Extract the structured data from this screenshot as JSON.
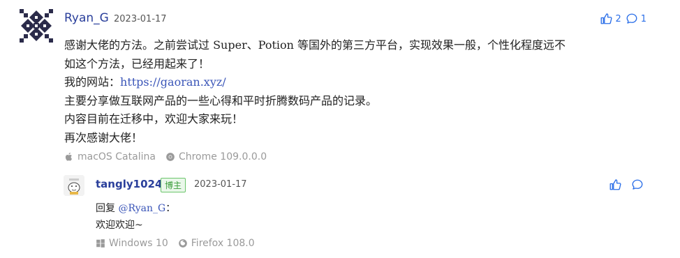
{
  "comment": {
    "author": "Ryan_G",
    "date": "2023-01-17",
    "like_count": "2",
    "reply_count": "1",
    "lines": {
      "line1": "感谢大佬的方法。之前尝试过 Super、Potion 等国外的第三方平台，实现效果一般，个性化程度远不",
      "line2": "如这个方法，已经用起来了！",
      "site_prefix": "我的网站：",
      "site_url": "https://gaoran.xyz/",
      "line4": "主要分享做互联网产品的一些心得和平时折腾数码产品的记录。",
      "line5": "内容目前在迁移中，欢迎大家来玩！",
      "line6": "再次感谢大佬！"
    },
    "os": "macOS Catalina",
    "browser": "Chrome 109.0.0.0"
  },
  "reply": {
    "author": "tangly1024",
    "badge": "博主",
    "date": "2023-01-17",
    "prefix": "回复",
    "mention": "@Ryan_G",
    "mention_suffix": "：",
    "content": "欢迎欢迎~",
    "os": "Windows 10",
    "browser": "Firefox 108.0"
  },
  "colors": {
    "author": "#2a3f9b",
    "accent": "#2a6ee8",
    "badge_bg": "#eaf7ea",
    "badge_text": "#3a9d3a",
    "meta": "#9a9a9a"
  },
  "icons": {
    "like": "thumbs-up-icon",
    "reply": "speech-bubble-icon",
    "os_main": "apple-icon",
    "browser_main": "chrome-icon",
    "os_reply": "windows-icon",
    "browser_reply": "firefox-icon"
  }
}
